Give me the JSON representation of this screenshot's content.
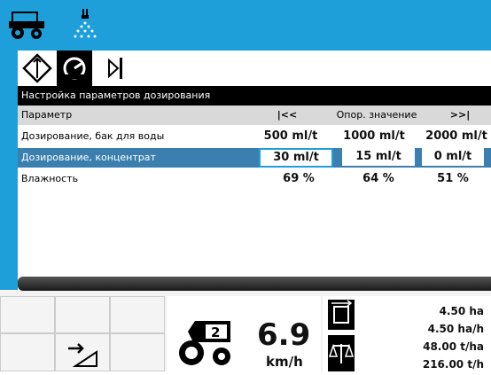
{
  "colors": {
    "accent": "#1f9fd9",
    "selected_row": "#3b7fae"
  },
  "toolbar": {
    "icons": [
      "harvester-icon",
      "spray-icon"
    ]
  },
  "tabs": [
    "diamond-arrows-icon",
    "gauge-icon",
    "play-bar-icon"
  ],
  "panel": {
    "title": "Настройка параметров дозирования",
    "header": {
      "param": "Параметр",
      "prev": "|<<",
      "ref": "Опор. значение",
      "next": ">>|"
    },
    "rows": [
      {
        "label": "Дозирование, бак для воды",
        "v1": "500 ml/t",
        "v2": "1000 ml/t",
        "v3": "2000 ml/t"
      },
      {
        "label": "Дозирование, концентрат",
        "v1": "30 ml/t",
        "v2": "15 ml/t",
        "v3": "0 ml/t"
      },
      {
        "label": "Влажность",
        "v1": "69 %",
        "v2": "64 %",
        "v3": "51 %"
      }
    ]
  },
  "status": {
    "speed_value": "6.9",
    "speed_unit": "km/h",
    "gear": "2",
    "area": "4.50 ha",
    "rate": "4.50 ha/h",
    "yield": "48.00 t/ha",
    "total": "216.00 t/h"
  }
}
